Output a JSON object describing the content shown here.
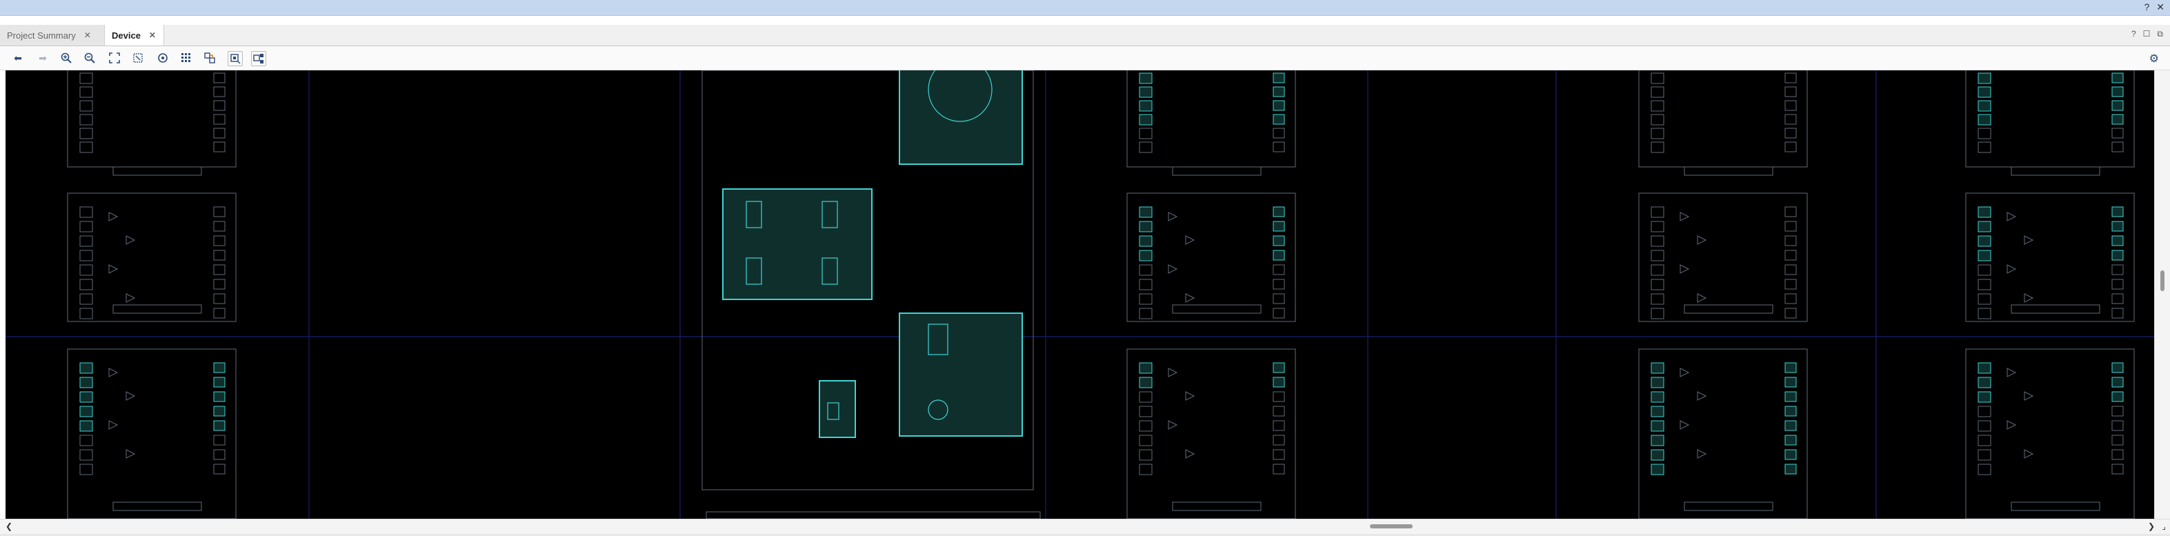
{
  "window": {
    "help_label": "?",
    "close_label": "✕"
  },
  "tabs": [
    {
      "label": "Project Summary",
      "active": false
    },
    {
      "label": "Device",
      "active": true
    }
  ],
  "tab_controls": {
    "help": "?",
    "restore": "☐",
    "maximize": "⧉"
  },
  "toolbar": {
    "back_icon": "arrow-left-icon",
    "forward_icon": "arrow-right-icon",
    "zoom_in_icon": "zoom-in-icon",
    "zoom_out_icon": "zoom-out-icon",
    "zoom_fit_icon": "zoom-fit-icon",
    "zoom_area_icon": "zoom-area-icon",
    "auto_fit_icon": "auto-fit-selection-icon",
    "grid_icon": "grid-icon",
    "routing_icon": "routing-resources-icon",
    "select_icon": "select-area-icon",
    "toggle_icon": "toggle-view-icon",
    "settings_icon": "gear-icon"
  },
  "colors": {
    "canvas_bg": "#000000",
    "site_outline": "#5f6b78",
    "cell_fill": "#0f2f2d",
    "cell_outline": "#3fd5d3",
    "clock_region": "#172070"
  }
}
